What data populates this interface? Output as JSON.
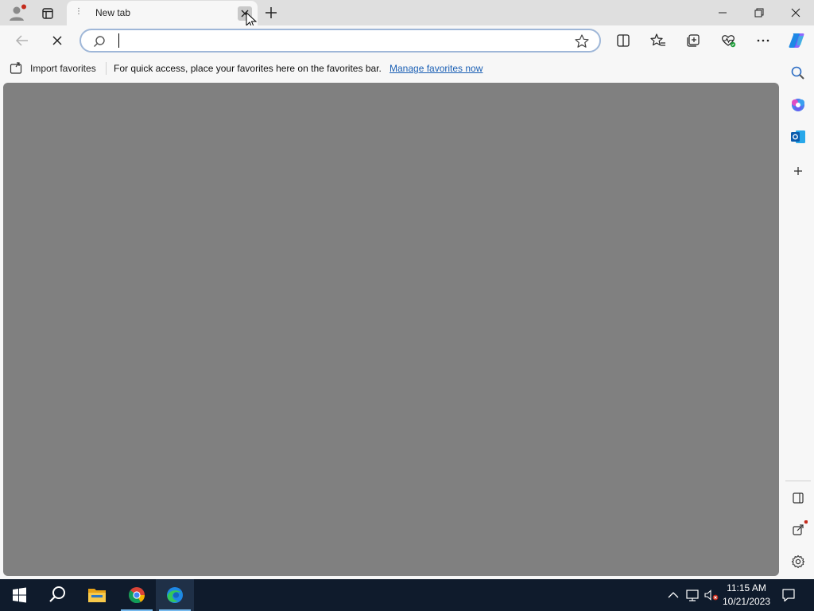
{
  "browser": {
    "tab": {
      "title": "New tab"
    }
  },
  "address_bar": {
    "value": "",
    "placeholder": ""
  },
  "favorites_bar": {
    "import_label": "Import favorites",
    "message": "For quick access, place your favorites here on the favorites bar.",
    "manage_link": "Manage favorites now"
  },
  "taskbar": {
    "time": "11:15 AM",
    "date": "10/21/2023"
  },
  "icons": {
    "titlebar": [
      "profile-icon",
      "tab-actions-icon",
      "new-tab-icon",
      "minimize-icon",
      "restore-icon",
      "close-icon"
    ],
    "toolbar": [
      "back-icon",
      "stop-loading-icon",
      "search-icon",
      "favorite-star-icon",
      "split-screen-icon",
      "favorites-icon",
      "collections-icon",
      "browser-essentials-icon",
      "more-icon",
      "copilot-icon"
    ],
    "sidebar": [
      "search-icon",
      "copilot-tools-icon",
      "outlook-icon",
      "add-icon",
      "sidebar-toggle-icon",
      "open-external-icon",
      "settings-icon"
    ],
    "taskbar": [
      "windows-start-icon",
      "search-icon",
      "file-explorer-icon",
      "chrome-icon",
      "edge-icon",
      "chevron-up-icon",
      "network-icon",
      "volume-muted-icon",
      "notifications-icon"
    ]
  },
  "colors": {
    "titlebar": "#dfdfdf",
    "toolbar": "#f7f7f7",
    "content": "#808080",
    "taskbar": "#0f1b2c",
    "link": "#1a5fb4",
    "accent_blue": "#76b9ed"
  }
}
